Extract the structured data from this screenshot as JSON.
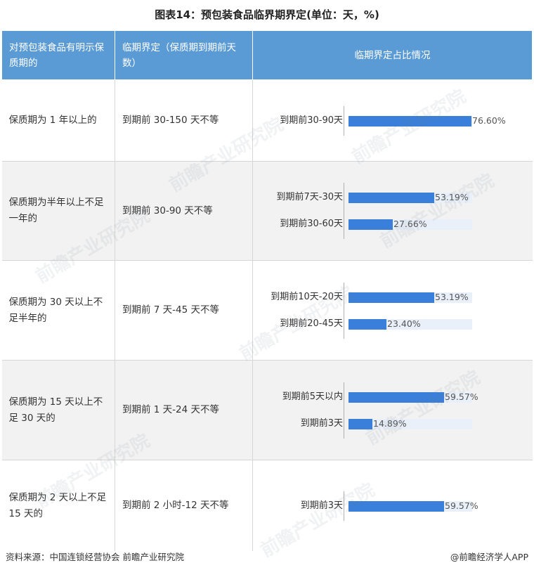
{
  "title": "图表14：预包装食品临界期界定(单位：天，%)",
  "headers": [
    "对预包装食品有明示保质期的",
    "临期界定（保质期到期前天数）",
    "临期界定占比情况"
  ],
  "rows": [
    {
      "shelf": "保质期为 1 年以上的",
      "range": "到期前 30-150 天不等",
      "bars": [
        {
          "label": "到期前30-90天",
          "value": 76.6,
          "text": "76.60%"
        }
      ]
    },
    {
      "shelf": "保质期为半年以上不足一年的",
      "range": "到期前 30-90 天不等",
      "bars": [
        {
          "label": "到期前7天-30天",
          "value": 53.19,
          "text": "53.19%"
        },
        {
          "label": "到期前30-60天",
          "value": 27.66,
          "text": "27.66%"
        }
      ]
    },
    {
      "shelf": "保质期为 30 天以上不足半年的",
      "range": "到期前 7 天-45 天不等",
      "bars": [
        {
          "label": "到期前10天-20天",
          "value": 53.19,
          "text": "53.19%"
        },
        {
          "label": "到期前20-45天",
          "value": 23.4,
          "text": "23.40%"
        }
      ]
    },
    {
      "shelf": "保质期为 15 天以上不足 30 天的",
      "range": "到期前 1 天-24 天不等",
      "bars": [
        {
          "label": "到期前5天以内",
          "value": 59.57,
          "text": "59.57%"
        },
        {
          "label": "到期前3天",
          "value": 14.89,
          "text": "14.89%"
        }
      ]
    },
    {
      "shelf": "保质期为 2 天以上不足 15 天的",
      "range": "到期前 2 小时-12 天不等",
      "bars": [
        {
          "label": "到期前3天",
          "value": 59.57,
          "text": "59.57%"
        }
      ]
    }
  ],
  "source": "资料来源：中国连锁经营协会 前瞻产业研究院",
  "brand": "@前瞻经济学人APP",
  "watermark": "前瞻产业研究院",
  "colors": {
    "header": "#5b9bd5",
    "bar": "#3a7fd9",
    "track": "#e9f0fa",
    "alt_row": "#f2f2f2"
  }
}
